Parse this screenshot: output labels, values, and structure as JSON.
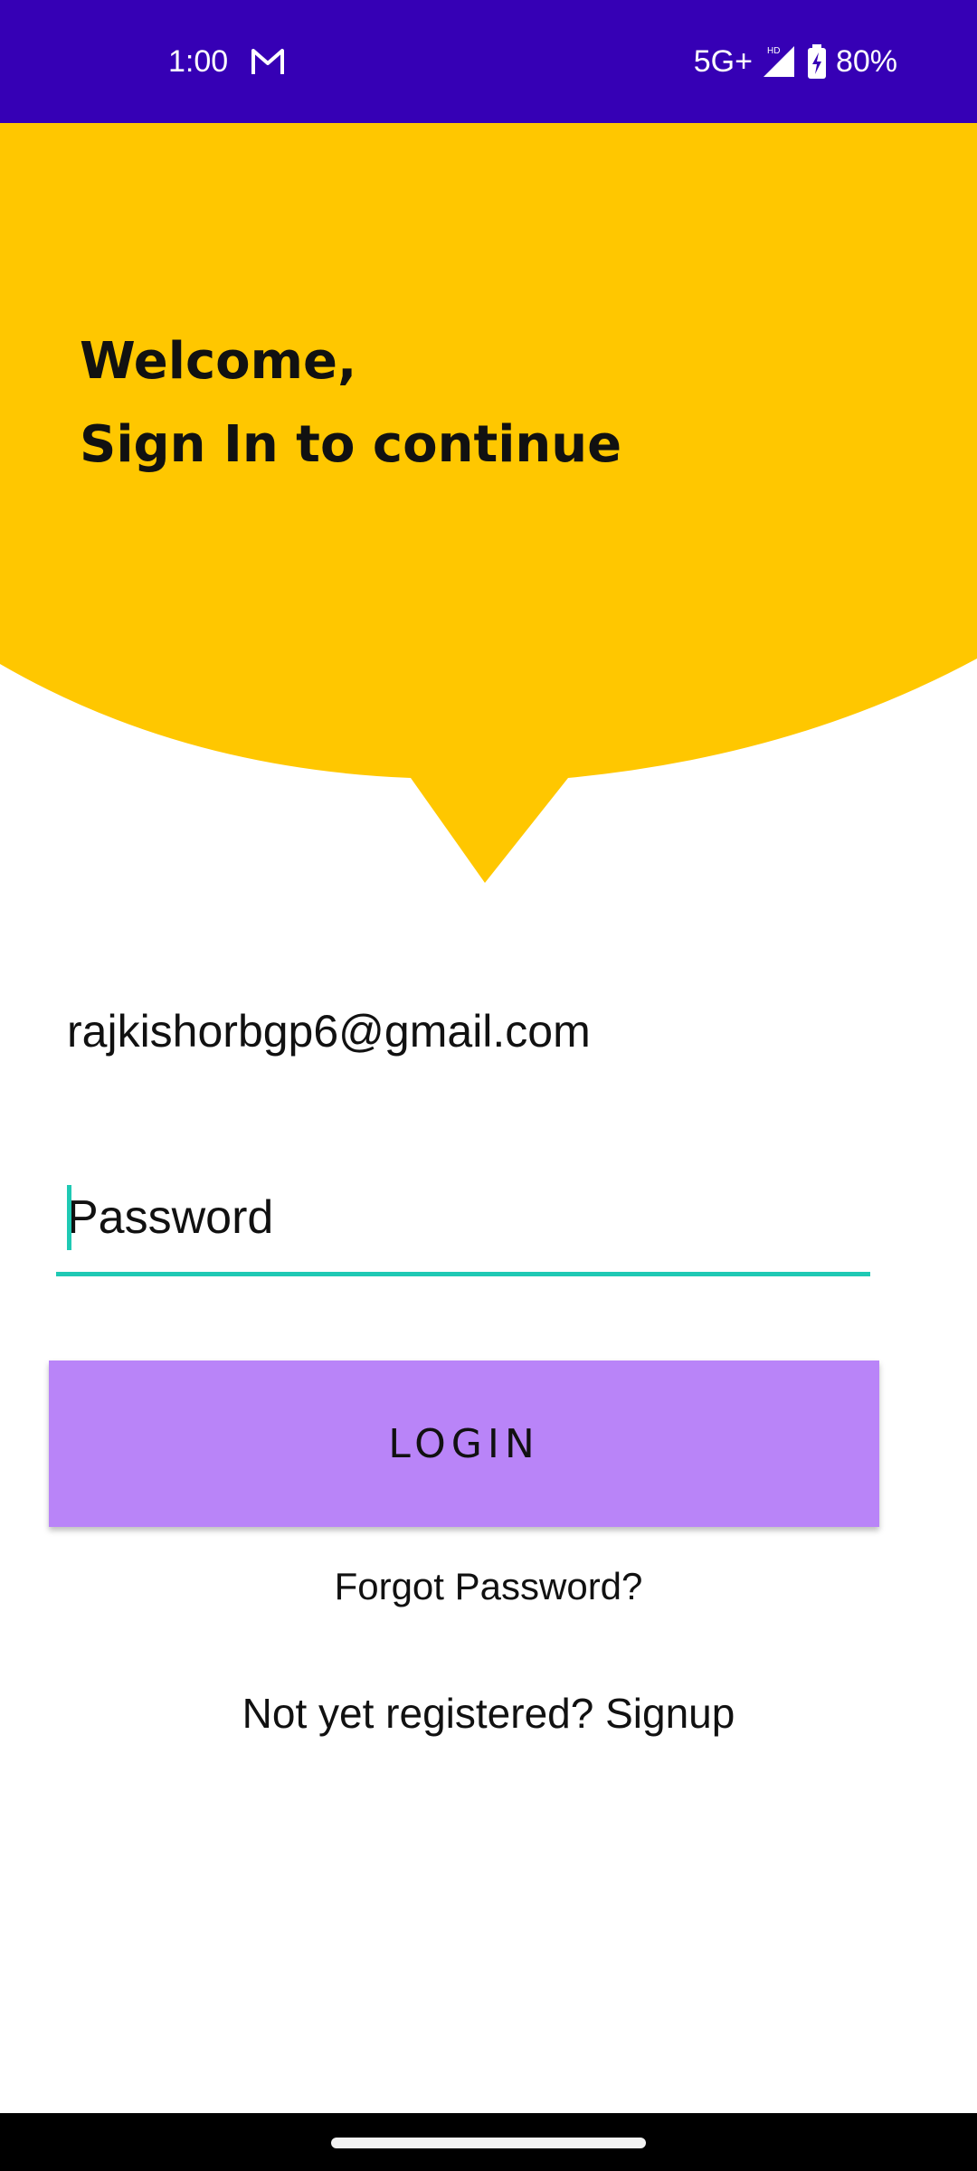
{
  "status_bar": {
    "time": "1:00",
    "network": "5G+",
    "hd_label": "HD",
    "battery": "80%",
    "icons": [
      "gmail-icon",
      "signal-icon",
      "battery-charging-icon"
    ]
  },
  "header": {
    "welcome_line1": "Welcome,",
    "welcome_line2": "Sign In to continue"
  },
  "form": {
    "email_value": "rajkishorbgp6@gmail.com",
    "password_placeholder": "Password",
    "login_label": "LOGIN",
    "forgot_label": "Forgot Password?",
    "signup_label": "Not yet registered? Signup"
  },
  "colors": {
    "status_bar": "#3600b5",
    "header": "#ffc700",
    "accent": "#1fc9b4",
    "login_button": "#b984f8"
  }
}
